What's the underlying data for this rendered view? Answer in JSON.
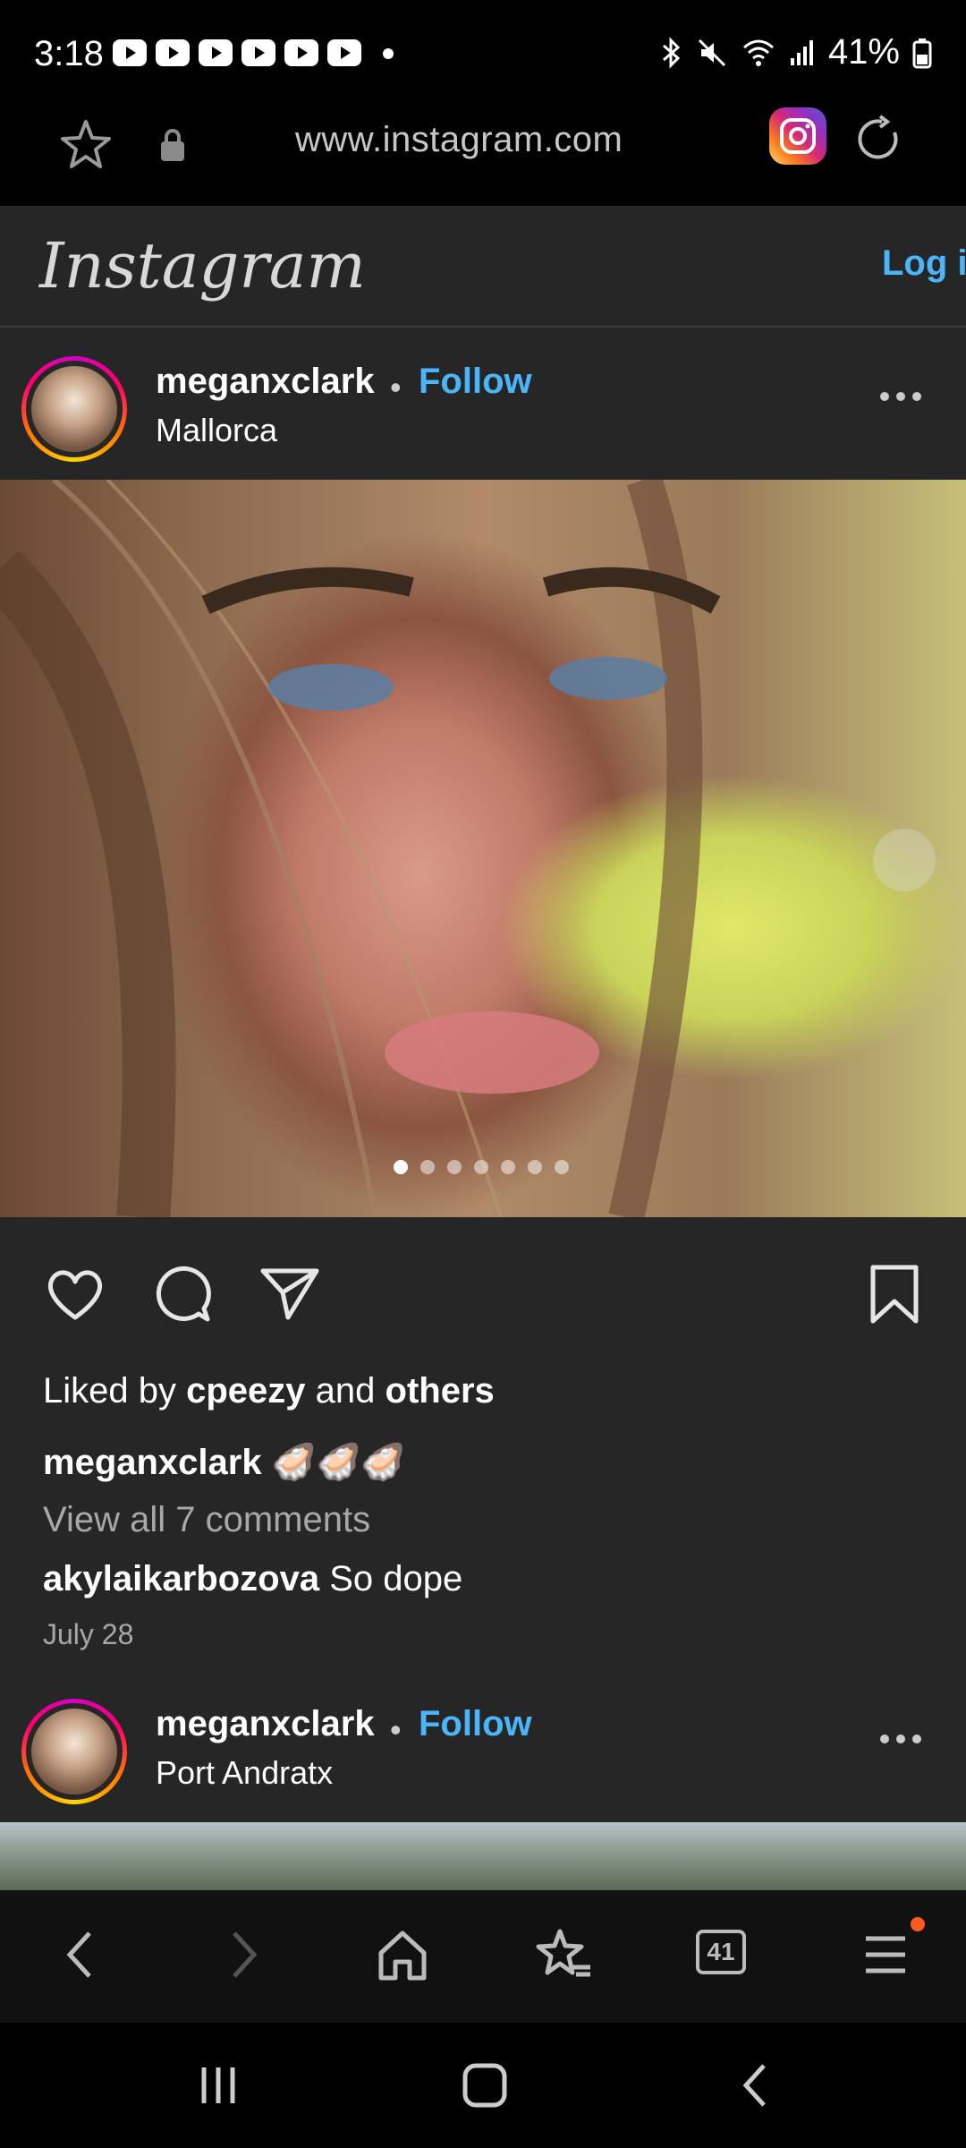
{
  "status_bar": {
    "time": "3:18",
    "battery": "41%",
    "notification_icons": [
      "youtube-icon",
      "youtube-icon",
      "youtube-icon",
      "youtube-icon",
      "youtube-icon",
      "youtube-icon"
    ]
  },
  "browser": {
    "url": "www.instagram.com",
    "tabs_count": "41"
  },
  "instagram": {
    "logo": "Instagram",
    "login_label": "Log in"
  },
  "post1": {
    "username": "meganxclark",
    "separator": "•",
    "follow_label": "Follow",
    "location": "Mallorca",
    "carousel_count": 7,
    "carousel_index": 1,
    "liked_prefix": "Liked by",
    "liked_user": "cpeezy",
    "liked_and": "and",
    "liked_others": "others",
    "caption_user": "meganxclark",
    "caption_text": "🦪🦪🦪",
    "view_comments": "View all 7 comments",
    "comment_user": "akylaikarbozova",
    "comment_text": "So dope",
    "date": "July 28"
  },
  "post2": {
    "username": "meganxclark",
    "separator": "•",
    "follow_label": "Follow",
    "location": "Port Andratx"
  },
  "colors": {
    "accent_blue": "#4cb5f9",
    "page_bg": "#262626"
  }
}
